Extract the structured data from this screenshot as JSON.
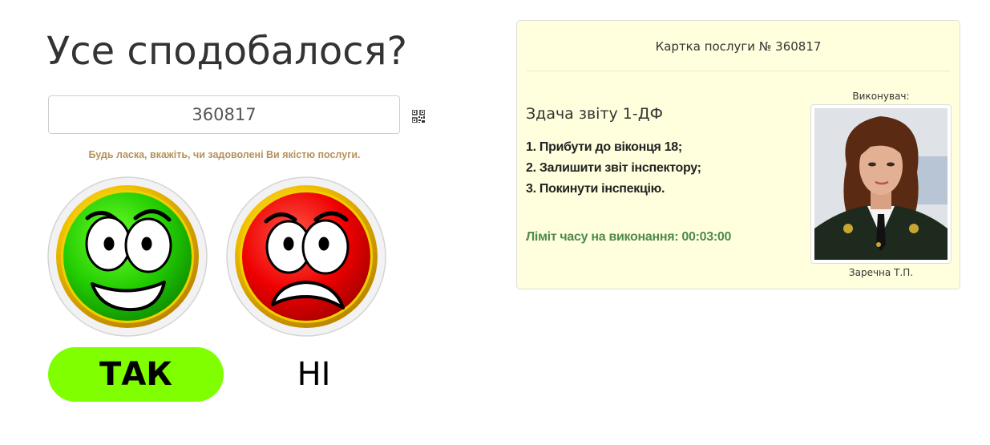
{
  "page": {
    "title": "Усе сподобалося?",
    "code_input_value": "360817",
    "hint": "Будь ласка, вкажіть, чи задоволені Ви якістю послуги.",
    "yes_label": "ТАК",
    "no_label": "НІ"
  },
  "icons": {
    "qr": "qr-code-icon",
    "happy": "happy-face-icon",
    "sad": "sad-face-icon"
  },
  "card": {
    "header": "Картка послуги № 360817",
    "service_name": "Здача звіту 1-ДФ",
    "steps": [
      "1. Прибути до віконця 18;",
      "2. Залишити звіт інспектору;",
      "3. Покинути інспекцію."
    ],
    "time_limit": "Ліміт часу на виконання: 00:03:00",
    "executor_label": "Виконувач:",
    "executor_name": "Заречна Т.П."
  },
  "colors": {
    "yes_button": "#7fff00",
    "card_background": "#ffffdd",
    "hint_text": "#b5925a",
    "time_limit_text": "#4e8a4e",
    "happy_face": "#22cc00",
    "sad_face": "#ee0000",
    "ring_gold": "#e8b800"
  }
}
